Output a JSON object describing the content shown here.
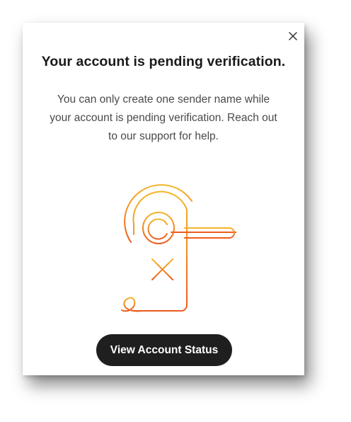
{
  "dialog": {
    "title": "Your account is pending verification.",
    "message_lines": [
      "You can only create one sender name while",
      "your account is pending verification. Reach out",
      "to our support for help."
    ],
    "close_icon": "close-icon",
    "illustration_icon": "door-hanger-x-icon",
    "button_label": "View Account Status"
  },
  "colors": {
    "button_bg": "#1f1f1f",
    "button_text": "#ffffff",
    "title_text": "#1a1a1a",
    "body_text": "#4a4a4a",
    "illustration_top": "#f5b62a",
    "illustration_bottom": "#ee5a1e"
  }
}
